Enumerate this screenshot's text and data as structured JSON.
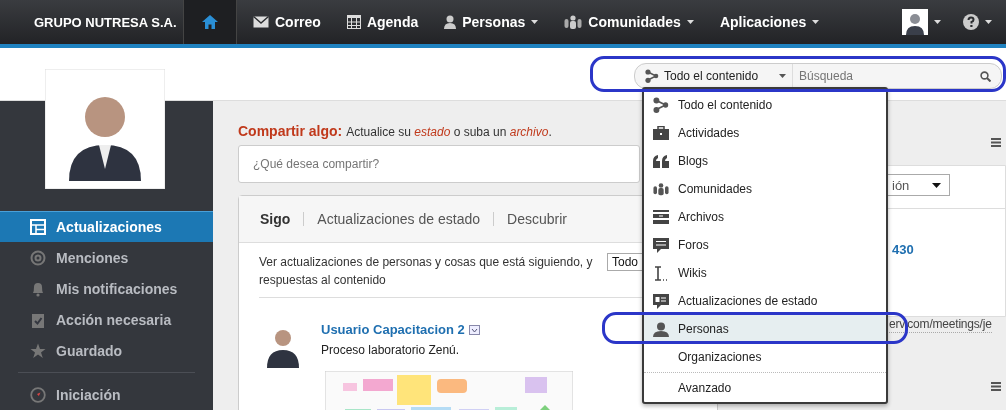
{
  "brand": "GRUPO NUTRESA S.A.",
  "nav": [
    {
      "kind": "home",
      "selected": true,
      "menu": false
    },
    {
      "kind": "mail",
      "label": "Correo",
      "selected": false,
      "menu": false
    },
    {
      "kind": "calendar",
      "label": "Agenda",
      "selected": false,
      "menu": false
    },
    {
      "kind": "person",
      "label": "Personas",
      "selected": false,
      "menu": true
    },
    {
      "kind": "group",
      "label": "Comunidades",
      "selected": false,
      "menu": true
    },
    {
      "kind": "none",
      "label": "Aplicaciones",
      "selected": false,
      "menu": true
    }
  ],
  "search": {
    "scope": "Todo el contenido",
    "placeholder": "Búsqueda"
  },
  "sidebar": {
    "items": [
      {
        "kind": "updates",
        "label": "Actualizaciones",
        "selected": true
      },
      {
        "kind": "at",
        "label": "Menciones",
        "selected": false
      },
      {
        "kind": "bell",
        "label": "Mis notificaciones",
        "selected": false
      },
      {
        "kind": "clipboard",
        "label": "Acción necesaria",
        "selected": false
      },
      {
        "kind": "star",
        "label": "Guardado",
        "selected": false
      },
      {
        "kind": "compass",
        "label": "Iniciación",
        "selected": false
      }
    ]
  },
  "share": {
    "title": "Compartir algo:",
    "text": "Actualice su *estado* o suba un *archivo*.",
    "placeholder": "¿Qué desea compartir?"
  },
  "tabs": [
    {
      "label": "Sigo",
      "selected": true
    },
    {
      "label": "Actualizaciones de estado",
      "selected": false
    },
    {
      "label": "Descubrir",
      "selected": false
    }
  ],
  "filter": {
    "description": "Ver actualizaciones de personas y cosas que está siguiendo, y respuestas al contenido",
    "value": "Todo"
  },
  "post": {
    "author": "Usuario Capacitacion 2",
    "text": "Proceso laboratorio Zenú."
  },
  "right": {
    "select_value": "ión",
    "link": "430",
    "url": "erv.com/meetings/je"
  },
  "search_menu": {
    "items": [
      {
        "kind": "all",
        "label": "Todo el contenido",
        "selected": false
      },
      {
        "kind": "briefcase",
        "label": "Actividades",
        "selected": false
      },
      {
        "kind": "quote",
        "label": "Blogs",
        "selected": false
      },
      {
        "kind": "group",
        "label": "Comunidades",
        "selected": false
      },
      {
        "kind": "cabinet",
        "label": "Archivos",
        "selected": false
      },
      {
        "kind": "bubble",
        "label": "Foros",
        "selected": false
      },
      {
        "kind": "cursor",
        "label": "Wikis",
        "selected": false
      },
      {
        "kind": "card",
        "label": "Actualizaciones de estado",
        "selected": false
      },
      {
        "kind": "person",
        "label": "Personas",
        "selected": true
      },
      {
        "kind": "none",
        "label": "Organizaciones",
        "selected": false
      },
      {
        "kind": "separator_none",
        "label": "Avanzado",
        "selected": false
      }
    ]
  }
}
